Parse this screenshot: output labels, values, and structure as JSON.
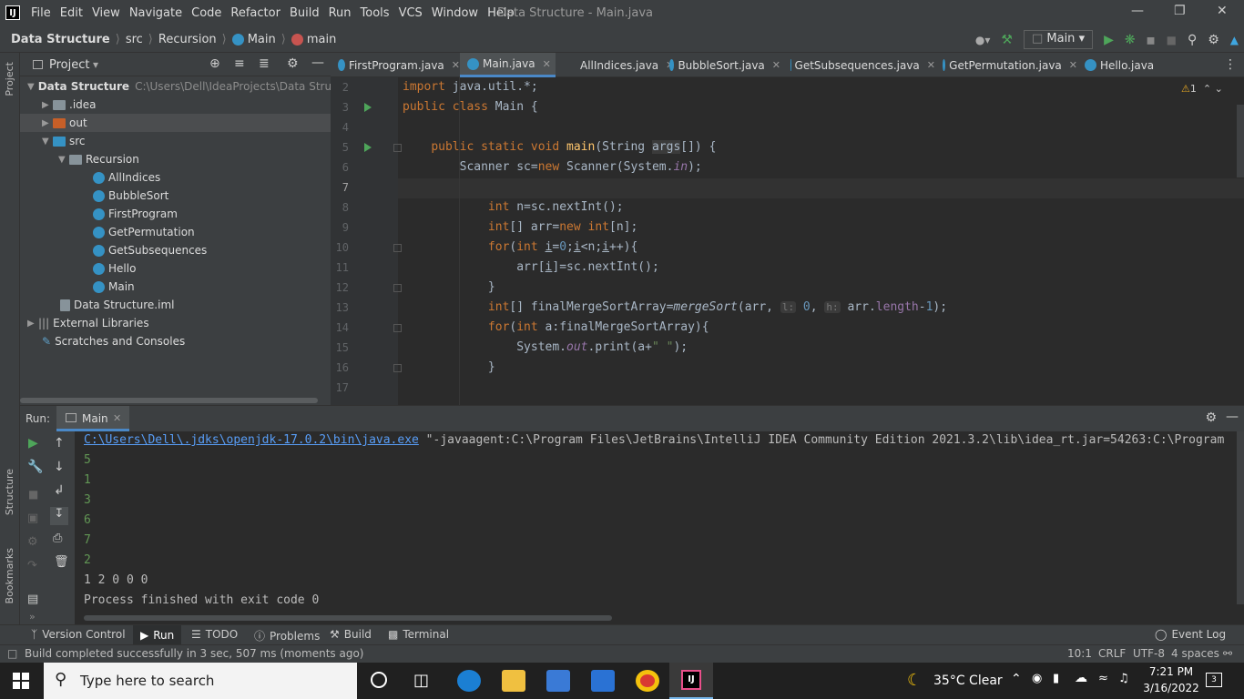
{
  "menubar": {
    "logo": "IJ",
    "items": [
      "File",
      "Edit",
      "View",
      "Navigate",
      "Code",
      "Refactor",
      "Build",
      "Run",
      "Tools",
      "VCS",
      "Window",
      "Help"
    ],
    "title": "Data Structure - Main.java"
  },
  "navbar": {
    "crumbs": [
      "Data Structure",
      "src",
      "Recursion",
      "Main",
      "main"
    ],
    "run_config": "Main"
  },
  "project": {
    "title": "Project",
    "root": "Data Structure",
    "root_path": "C:\\Users\\Dell\\IdeaProjects\\Data Structu",
    "items": [
      ".idea",
      "out",
      "src",
      "Recursion",
      "AllIndices",
      "BubbleSort",
      "FirstProgram",
      "GetPermutation",
      "GetSubsequences",
      "Hello",
      "Main",
      "Data Structure.iml",
      "External Libraries",
      "Scratches and Consoles"
    ]
  },
  "tabs": [
    "FirstProgram.java",
    "Main.java",
    "AllIndices.java",
    "BubbleSort.java",
    "GetSubsequences.java",
    "GetPermutation.java",
    "Hello.java"
  ],
  "editor": {
    "line_numbers": [
      "2",
      "3",
      "4",
      "5",
      "6",
      "7",
      "8",
      "9",
      "10",
      "11",
      "12",
      "13",
      "14",
      "15",
      "16",
      "17"
    ],
    "warnings": "1",
    "hint_l": "l:",
    "hint_h": "h:"
  },
  "run": {
    "label": "Run:",
    "tab": "Main",
    "cmd_link": "C:\\Users\\Dell\\.jdks\\openjdk-17.0.2\\bin\\java.exe",
    "cmd_rest": " \"-javaagent:C:\\Program Files\\JetBrains\\IntelliJ IDEA Community Edition 2021.3.2\\lib\\idea_rt.jar=54263:C:\\Program",
    "inputs": [
      "5",
      "1",
      "3",
      "6",
      "7",
      "2"
    ],
    "result": "1 2 0 0 0",
    "exit": "Process finished with exit code 0"
  },
  "left_strip": {
    "project": "Project",
    "structure": "Structure",
    "bookmarks": "Bookmarks"
  },
  "bottom_tabs": [
    "Version Control",
    "Run",
    "TODO",
    "Problems",
    "Build",
    "Terminal"
  ],
  "event_log": "Event Log",
  "status": {
    "message": "Build completed successfully in 3 sec, 507 ms (moments ago)",
    "pos": "10:1",
    "eol": "CRLF",
    "enc": "UTF-8",
    "indent": "4 spaces"
  },
  "taskbar": {
    "search_placeholder": "Type here to search",
    "weather": "35°C  Clear",
    "time": "7:21 PM",
    "date": "3/16/2022",
    "notif": "3"
  },
  "colors": {
    "accent": "#4a88c7",
    "run_green": "#4ea55a",
    "keyword": "#cc7832"
  }
}
